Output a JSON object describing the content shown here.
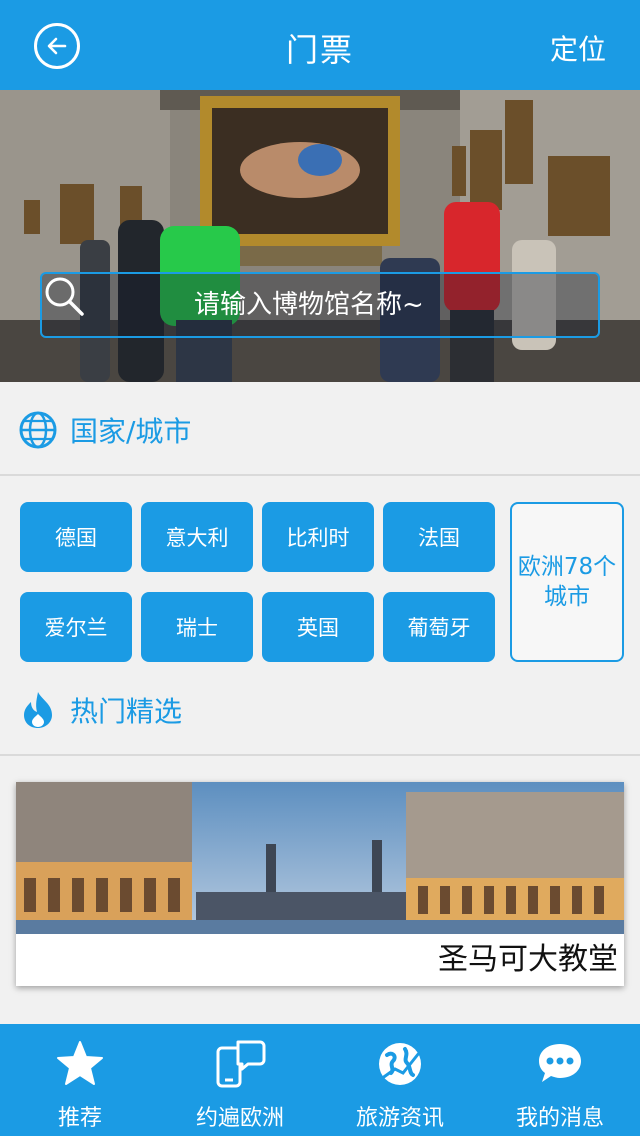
{
  "header": {
    "title": "门票",
    "locate_label": "定位"
  },
  "search": {
    "placeholder": "请输入博物馆名称~"
  },
  "country_section": {
    "title": "国家/城市",
    "countries": [
      "德国",
      "意大利",
      "比利时",
      "法国",
      "爱尔兰",
      "瑞士",
      "英国",
      "葡萄牙"
    ],
    "cities_button": "欧洲78个城市"
  },
  "hot_section": {
    "title": "热门精选",
    "featured": {
      "title": "圣马可大教堂"
    }
  },
  "tabbar": {
    "tabs": [
      {
        "label": "推荐",
        "icon": "star-icon"
      },
      {
        "label": "约遍欧洲",
        "icon": "phone-chat-icon"
      },
      {
        "label": "旅游资讯",
        "icon": "globe-plane-icon"
      },
      {
        "label": "我的消息",
        "icon": "chat-bubble-icon"
      }
    ]
  },
  "colors": {
    "primary": "#1b9be4",
    "background": "#f1f1f1"
  }
}
